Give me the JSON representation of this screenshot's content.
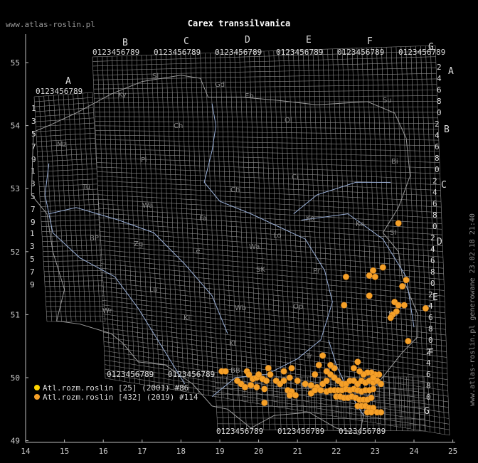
{
  "header": {
    "site": "www.atlas-roslin.pl",
    "title": "Carex transsilvanica",
    "stamp": "www.atlas-roslin.pl generowane 23.02.18 21:40"
  },
  "axes": {
    "x_ticks": [
      "14",
      "15",
      "16",
      "17",
      "18",
      "19",
      "20",
      "21",
      "22",
      "23",
      "24",
      "25"
    ],
    "y_ticks": [
      "55",
      "54",
      "53",
      "52",
      "51",
      "50",
      "49"
    ]
  },
  "grid": {
    "top_letters": [
      "A",
      "B",
      "C",
      "D",
      "E",
      "F",
      "G"
    ],
    "top_digits": "0123456789",
    "right_letters": [
      "A",
      "B",
      "C",
      "D",
      "E",
      "F",
      "G"
    ],
    "bottom_digits": "0123456789",
    "left_digits": [
      "1",
      "3",
      "5",
      "7",
      "9"
    ]
  },
  "regions": [
    "Sl",
    "Ky",
    "Gd",
    "Eb",
    "Su",
    "Ch",
    "Ol",
    "Pi",
    "Ci",
    "Bi",
    "Mz",
    "Tu",
    "Ch",
    "Wa",
    "Fa",
    "Ko",
    "Ka",
    "SI",
    "BP",
    "Zg",
    "Le",
    "Wa",
    "Lo",
    "SK",
    "Pr",
    "Rd",
    "Lu",
    "Wr",
    "Wb",
    "Op",
    "Ki",
    "Kt",
    "BB",
    "Tr",
    "Ma",
    "Kr"
  ],
  "legend": [
    {
      "label": "Atl.rozm.roslin [25] (2001) #86",
      "color": "#ffd400"
    },
    {
      "label": "Atl.rozm.roslin [432] (2019) #114",
      "color": "#f5a028"
    }
  ],
  "colors": {
    "grid": "#8c8c8c",
    "rivers": "#9ab0d8",
    "borders": "#9a9a9a",
    "dot": "#f5a028"
  },
  "points": [
    [
      23.6,
      52.45
    ],
    [
      23.2,
      51.75
    ],
    [
      22.95,
      51.7
    ],
    [
      22.85,
      51.62
    ],
    [
      23.0,
      51.6
    ],
    [
      22.25,
      51.6
    ],
    [
      23.8,
      51.55
    ],
    [
      23.7,
      51.45
    ],
    [
      22.85,
      51.3
    ],
    [
      22.2,
      51.15
    ],
    [
      23.5,
      51.2
    ],
    [
      23.6,
      51.15
    ],
    [
      23.75,
      51.15
    ],
    [
      23.55,
      51.05
    ],
    [
      23.45,
      51.0
    ],
    [
      23.4,
      50.95
    ],
    [
      24.3,
      51.1
    ],
    [
      23.85,
      50.58
    ],
    [
      22.55,
      50.25
    ],
    [
      21.65,
      50.35
    ],
    [
      20.25,
      50.15
    ],
    [
      20.65,
      50.1
    ],
    [
      20.85,
      50.15
    ],
    [
      19.05,
      50.1
    ],
    [
      19.15,
      50.1
    ],
    [
      19.7,
      50.1
    ],
    [
      19.75,
      50.05
    ],
    [
      19.85,
      49.98
    ],
    [
      19.95,
      50.0
    ],
    [
      20.0,
      50.05
    ],
    [
      20.1,
      49.98
    ],
    [
      20.2,
      49.95
    ],
    [
      20.3,
      50.05
    ],
    [
      20.45,
      49.95
    ],
    [
      20.55,
      49.9
    ],
    [
      20.65,
      49.95
    ],
    [
      20.8,
      50.0
    ],
    [
      19.55,
      49.9
    ],
    [
      19.45,
      49.95
    ],
    [
      19.65,
      49.85
    ],
    [
      19.8,
      49.88
    ],
    [
      19.95,
      49.85
    ],
    [
      20.15,
      49.82
    ],
    [
      20.75,
      49.8
    ],
    [
      20.85,
      49.78
    ],
    [
      20.95,
      49.72
    ],
    [
      20.8,
      49.72
    ],
    [
      21.2,
      49.9
    ],
    [
      21.35,
      49.88
    ],
    [
      21.5,
      49.85
    ],
    [
      21.65,
      49.9
    ],
    [
      21.75,
      49.95
    ],
    [
      21.85,
      50.05
    ],
    [
      21.95,
      50.0
    ],
    [
      22.05,
      49.95
    ],
    [
      22.15,
      49.9
    ],
    [
      22.25,
      49.9
    ],
    [
      22.35,
      49.95
    ],
    [
      22.45,
      49.95
    ],
    [
      22.55,
      49.9
    ],
    [
      22.65,
      49.95
    ],
    [
      22.75,
      49.92
    ],
    [
      22.85,
      49.95
    ],
    [
      22.95,
      49.92
    ],
    [
      23.05,
      49.95
    ],
    [
      23.15,
      49.9
    ],
    [
      23.1,
      50.05
    ],
    [
      23.0,
      50.05
    ],
    [
      22.9,
      50.08
    ],
    [
      22.8,
      50.08
    ],
    [
      22.7,
      50.05
    ],
    [
      22.6,
      50.1
    ],
    [
      22.45,
      50.15
    ],
    [
      21.95,
      50.15
    ],
    [
      21.85,
      50.2
    ],
    [
      21.55,
      50.2
    ],
    [
      21.75,
      50.1
    ],
    [
      21.45,
      50.05
    ],
    [
      21.35,
      49.75
    ],
    [
      21.45,
      49.8
    ],
    [
      21.6,
      49.8
    ],
    [
      21.75,
      49.78
    ],
    [
      21.85,
      49.8
    ],
    [
      21.95,
      49.8
    ],
    [
      22.05,
      49.8
    ],
    [
      22.15,
      49.8
    ],
    [
      22.25,
      49.82
    ],
    [
      22.35,
      49.8
    ],
    [
      22.45,
      49.82
    ],
    [
      22.55,
      49.8
    ],
    [
      22.65,
      49.78
    ],
    [
      22.75,
      49.8
    ],
    [
      22.85,
      49.8
    ],
    [
      22.95,
      49.82
    ],
    [
      22.0,
      49.7
    ],
    [
      22.1,
      49.7
    ],
    [
      22.2,
      49.68
    ],
    [
      22.3,
      49.68
    ],
    [
      22.4,
      49.7
    ],
    [
      22.5,
      49.68
    ],
    [
      22.6,
      49.65
    ],
    [
      22.7,
      49.65
    ],
    [
      22.8,
      49.65
    ],
    [
      22.9,
      49.68
    ],
    [
      22.55,
      49.55
    ],
    [
      22.65,
      49.55
    ],
    [
      22.75,
      49.55
    ],
    [
      22.85,
      49.52
    ],
    [
      22.95,
      49.52
    ],
    [
      22.8,
      49.45
    ],
    [
      22.9,
      49.45
    ],
    [
      23.05,
      49.45
    ],
    [
      23.15,
      49.45
    ],
    [
      20.15,
      49.6
    ],
    [
      21.0,
      49.95
    ],
    [
      22.95,
      50.0
    ]
  ]
}
